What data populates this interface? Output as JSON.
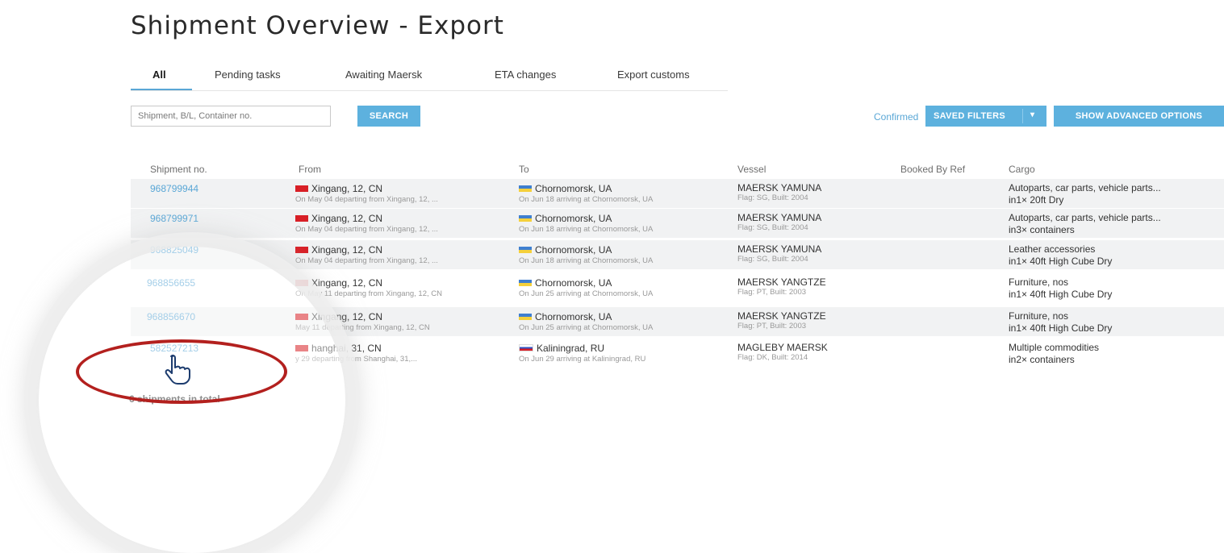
{
  "page": {
    "title": "Shipment Overview - Export"
  },
  "tabs": [
    {
      "label": "All",
      "active": true
    },
    {
      "label": "Pending tasks"
    },
    {
      "label": "Awaiting Maersk"
    },
    {
      "label": "ETA changes"
    },
    {
      "label": "Export customs"
    }
  ],
  "search": {
    "placeholder": "Shipment, B/L, Container no.",
    "value": "",
    "button_label": "SEARCH"
  },
  "filters": {
    "confirmed_label": "Confirmed",
    "saved_filters_label": "SAVED FILTERS",
    "advanced_label": "SHOW ADVANCED OPTIONS"
  },
  "table": {
    "columns": [
      "Shipment no.",
      "From",
      "To",
      "Vessel",
      "Booked By Ref",
      "Cargo"
    ],
    "rows": [
      {
        "shipment_no": "968799944",
        "from_flag": "cn-flag",
        "from": "Xingang, 12, CN",
        "from_detail": "On May 04 departing from Xingang, 12, ...",
        "to_flag": "ua-flag",
        "to": "Chornomorsk, UA",
        "to_detail": "On Jun 18 arriving at Chornomorsk, UA",
        "vessel": "MAERSK YAMUNA",
        "vessel_detail": "Flag: SG, Built: 2004",
        "booked_by_ref": "",
        "cargo": "Autoparts, car parts, vehicle parts...",
        "cargo_detail": "in1× 20ft Dry"
      },
      {
        "shipment_no": "968799971",
        "from_flag": "cn-flag",
        "from": "Xingang, 12, CN",
        "from_detail": "On May 04 departing from Xingang, 12, ...",
        "to_flag": "ua-flag",
        "to": "Chornomorsk, UA",
        "to_detail": "On Jun 18 arriving at Chornomorsk, UA",
        "vessel": "MAERSK YAMUNA",
        "vessel_detail": "Flag: SG, Built: 2004",
        "booked_by_ref": "",
        "cargo": "Autoparts, car parts, vehicle parts...",
        "cargo_detail": "in3× containers"
      },
      {
        "shipment_no": "968825049",
        "from_flag": "cn-flag",
        "from": "Xingang, 12, CN",
        "from_detail": "On May 04 departing from Xingang, 12, ...",
        "to_flag": "ua-flag",
        "to": "Chornomorsk, UA",
        "to_detail": "On Jun 18 arriving at Chornomorsk, UA",
        "vessel": "MAERSK YAMUNA",
        "vessel_detail": "Flag: SG, Built: 2004",
        "booked_by_ref": "",
        "cargo": "Leather accessories",
        "cargo_detail": "in1× 40ft High Cube Dry"
      },
      {
        "shipment_no": "968856655",
        "from_flag": "cn-flag",
        "from": "Xingang, 12, CN",
        "from_detail": "On May 11 departing from Xingang, 12, CN",
        "to_flag": "ua-flag",
        "to": "Chornomorsk, UA",
        "to_detail": "On Jun 25 arriving at Chornomorsk, UA",
        "vessel": "MAERSK YANGTZE",
        "vessel_detail": "Flag: PT, Built: 2003",
        "booked_by_ref": "",
        "cargo": "Furniture, nos",
        "cargo_detail": "in1× 40ft High Cube Dry"
      },
      {
        "shipment_no": "968856670",
        "from_flag": "cn-flag",
        "from": "Xingang, 12, CN",
        "from_detail": "May 11 departing from Xingang, 12, CN",
        "to_flag": "ua-flag",
        "to": "Chornomorsk, UA",
        "to_detail": "On Jun 25 arriving at Chornomorsk, UA",
        "vessel": "MAERSK YANGTZE",
        "vessel_detail": "Flag: PT, Built: 2003",
        "booked_by_ref": "",
        "cargo": "Furniture, nos",
        "cargo_detail": "in1× 40ft High Cube Dry"
      },
      {
        "shipment_no": "582527213",
        "from_flag": "cn-flag",
        "from": "hanghai, 31, CN",
        "from_detail": "y 29 departing from Shanghai, 31,...",
        "to_flag": "ru-flag",
        "to": "Kaliningrad, RU",
        "to_detail": "On Jun 29 arriving at Kaliningrad, RU",
        "vessel": "MAGLEBY MAERSK",
        "vessel_detail": "Flag: DK, Built: 2014",
        "booked_by_ref": "",
        "cargo": "Multiple commodities",
        "cargo_detail": "in2× containers"
      }
    ]
  },
  "footer": {
    "total_label": "6 shipments in total"
  },
  "colors": {
    "accent": "#5aa7d6",
    "button": "#5db1de",
    "highlight_ring": "#b3201e"
  },
  "icons": {
    "pointer": "hand-pointer-icon"
  }
}
